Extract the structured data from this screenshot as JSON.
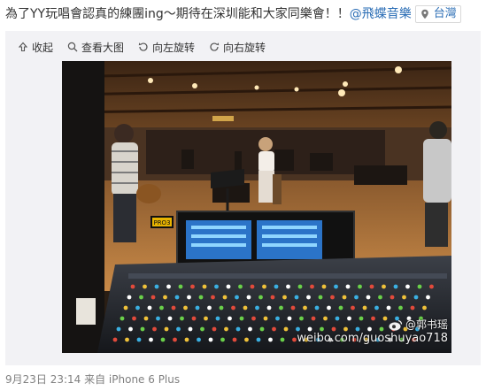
{
  "post": {
    "text": "為了YY玩唱會認真的練團ing～期待在深圳能和大家同樂會！！",
    "mention": "@飛蝶音樂",
    "location": "台灣"
  },
  "toolbar": {
    "collapse": "收起",
    "view_large": "查看大图",
    "rotate_left": "向左旋转",
    "rotate_right": "向右旋转"
  },
  "photo": {
    "console_brand": "PRO3",
    "watermark_name": "@郭书瑶",
    "watermark_url": "weibo.com/guoshuyao718"
  },
  "footer": {
    "meta": "9月23日 23:14 来自 iPhone 6 Plus"
  }
}
